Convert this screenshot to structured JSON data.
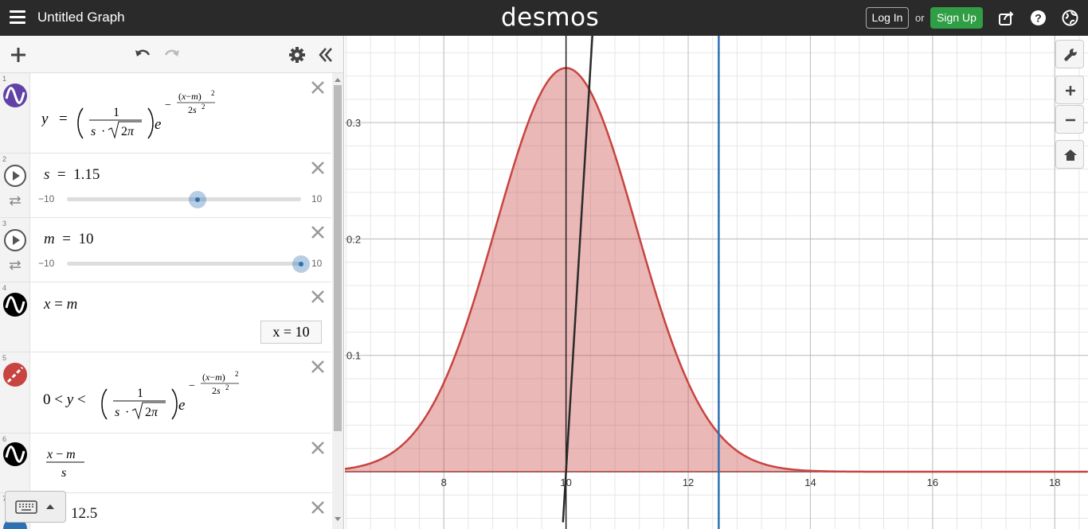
{
  "header": {
    "title": "Untitled Graph",
    "logo": "desmos",
    "login_label": "Log In",
    "or_label": "or",
    "signup_label": "Sign Up",
    "signup_color": "#2f9e44"
  },
  "expressions": [
    {
      "num": "1",
      "icon": "wave-icon",
      "color": "#6042a6"
    },
    {
      "num": "2",
      "latex_lhs": "s",
      "value": "1.15",
      "slider_min": "−10",
      "slider_max": "10",
      "slider_fraction": 0.5575
    },
    {
      "num": "3",
      "latex_lhs": "m",
      "value": "10",
      "slider_min": "−10",
      "slider_max": "10",
      "slider_fraction": 1.0
    },
    {
      "num": "4",
      "eval_value": "x = 10"
    },
    {
      "num": "5",
      "icon": "region-icon",
      "color": "#c74440"
    },
    {
      "num": "6"
    },
    {
      "num": "7",
      "value": "12.5"
    }
  ],
  "graph": {
    "x_ticks": [
      "8",
      "10",
      "12",
      "14",
      "16",
      "18"
    ],
    "y_ticks": [
      "0.3",
      "0.2",
      "0.1"
    ],
    "curve_color": "#c74440",
    "vline_color": "#2d70b3",
    "tangent_color": "#000000"
  }
}
